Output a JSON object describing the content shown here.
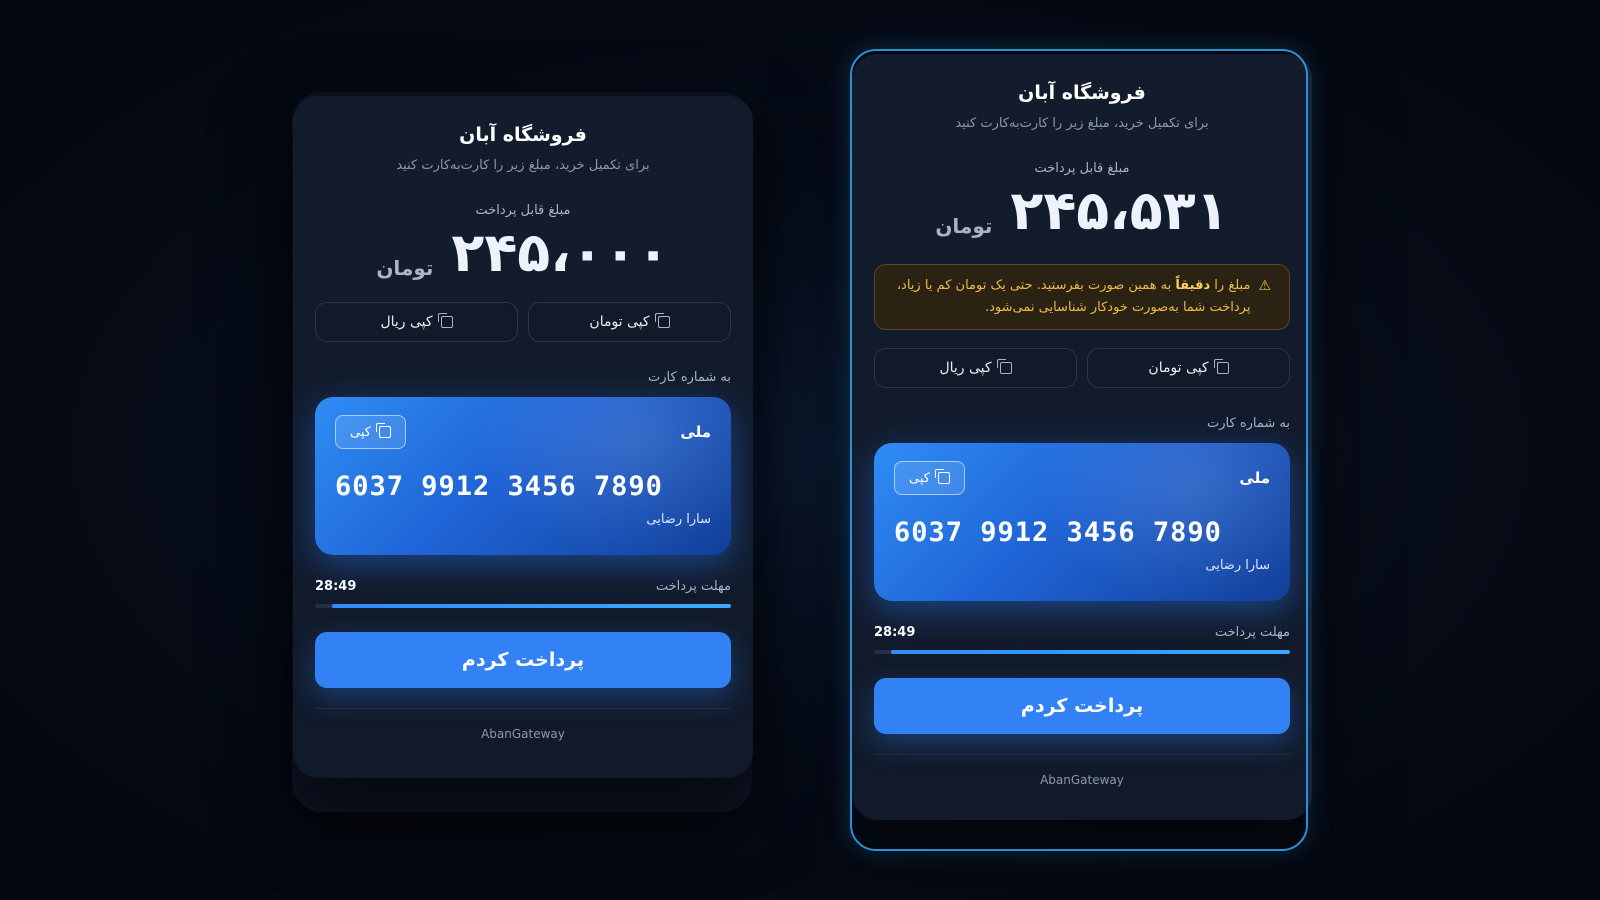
{
  "left_card": {
    "store_name": "فروشگاه آبان",
    "subtitle": "برای تکمیل خرید، مبلغ زیر را کارت‌به‌کارت کنید",
    "amount_label": "مبلغ قابل پرداخت",
    "amount": "۲۴۵،۰۰۰",
    "currency": "تومان",
    "copy_toman_label": "کپی تومان",
    "copy_rial_label": "کپی ریال",
    "card_label": "به شماره کارت",
    "bank_name": "ملی",
    "bank_copy_label": "کپی",
    "card_number": "6037 9912 3456 7890",
    "holder_name": "سارا رضایی",
    "timer_label": "مهلت پرداخت",
    "timer_value": "28:49",
    "progress_fraction": 0.96,
    "pay_button_label": "پرداخت کردم",
    "footer": "AbanGateway"
  },
  "right_card": {
    "store_name": "فروشگاه آبان",
    "subtitle": "برای تکمیل خرید، مبلغ زیر را کارت‌به‌کارت کنید",
    "amount_label": "مبلغ قابل پرداخت",
    "amount": "۲۴۵،۵۳۱",
    "currency": "تومان",
    "warning_before": "مبلغ را",
    "warning_strong": "دقیقاً",
    "warning_after": "به همین صورت بفرستید. حتی یک تومان کم یا زیاد، پرداخت شما به‌صورت خودکار شناسایی نمی‌شود.",
    "copy_toman_label": "کپی تومان",
    "copy_rial_label": "کپی ریال",
    "card_label": "به شماره کارت",
    "bank_name": "ملی",
    "bank_copy_label": "کپی",
    "card_number": "6037 9912 3456 7890",
    "holder_name": "سارا رضایی",
    "timer_label": "مهلت پرداخت",
    "timer_value": "28:49",
    "progress_fraction": 0.96,
    "pay_button_label": "پرداخت کردم",
    "footer": "AbanGateway"
  },
  "icons": {
    "copy": "copy-icon",
    "warning": "warning-icon"
  },
  "colors": {
    "accent": "#3282f6",
    "warning": "#f0b94a",
    "focus_ring": "#2f8fd6"
  }
}
